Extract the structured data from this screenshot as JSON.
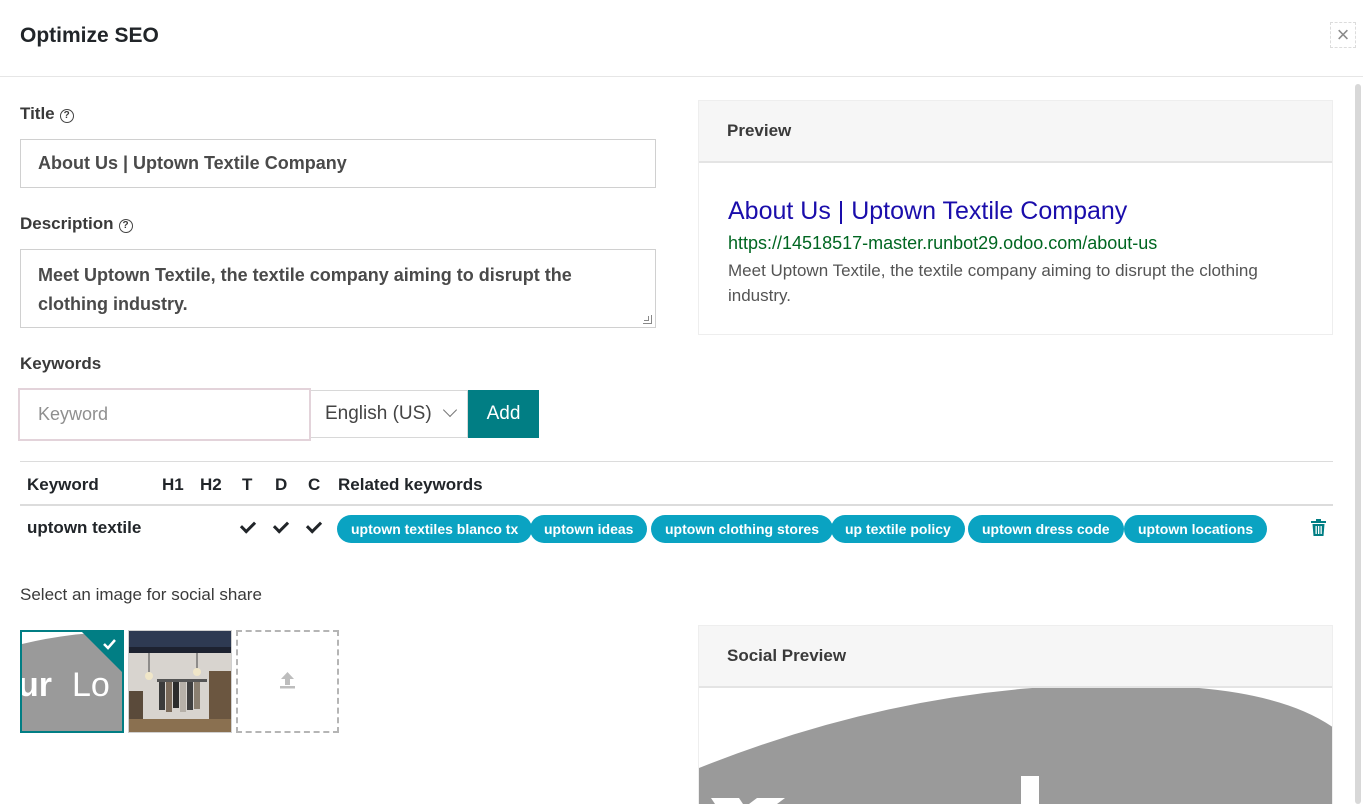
{
  "dialog": {
    "title": "Optimize SEO",
    "close_label": "×"
  },
  "form": {
    "title_label": "Title",
    "title_value": "About Us | Uptown Textile Company",
    "description_label": "Description",
    "description_value": "Meet Uptown Textile, the textile company aiming to disrupt the clothing industry.",
    "keywords_label": "Keywords",
    "keyword_placeholder": "Keyword",
    "language": "English (US)",
    "add_label": "Add"
  },
  "keywords_table": {
    "headers": [
      "Keyword",
      "H1",
      "H2",
      "T",
      "D",
      "C",
      "Related keywords"
    ],
    "rows": [
      {
        "keyword": "uptown textile",
        "h1": false,
        "h2": false,
        "t": true,
        "d": true,
        "c": true,
        "related": [
          "uptown textiles blanco tx",
          "uptown ideas",
          "uptown clothing stores",
          "up textile policy",
          "uptown dress code",
          "uptown locations"
        ]
      }
    ]
  },
  "social": {
    "label": "Select an image for social share"
  },
  "preview": {
    "heading": "Preview",
    "title": "About Us | Uptown Textile Company",
    "url": "https://14518517-master.runbot29.odoo.com/about-us",
    "description": "Meet Uptown Textile, the textile company aiming to disrupt the clothing industry."
  },
  "social_preview": {
    "heading": "Social Preview"
  },
  "colors": {
    "primary": "#017e84",
    "chip": "#0aa3c2",
    "link": "#1a0dab",
    "url": "#006621"
  }
}
